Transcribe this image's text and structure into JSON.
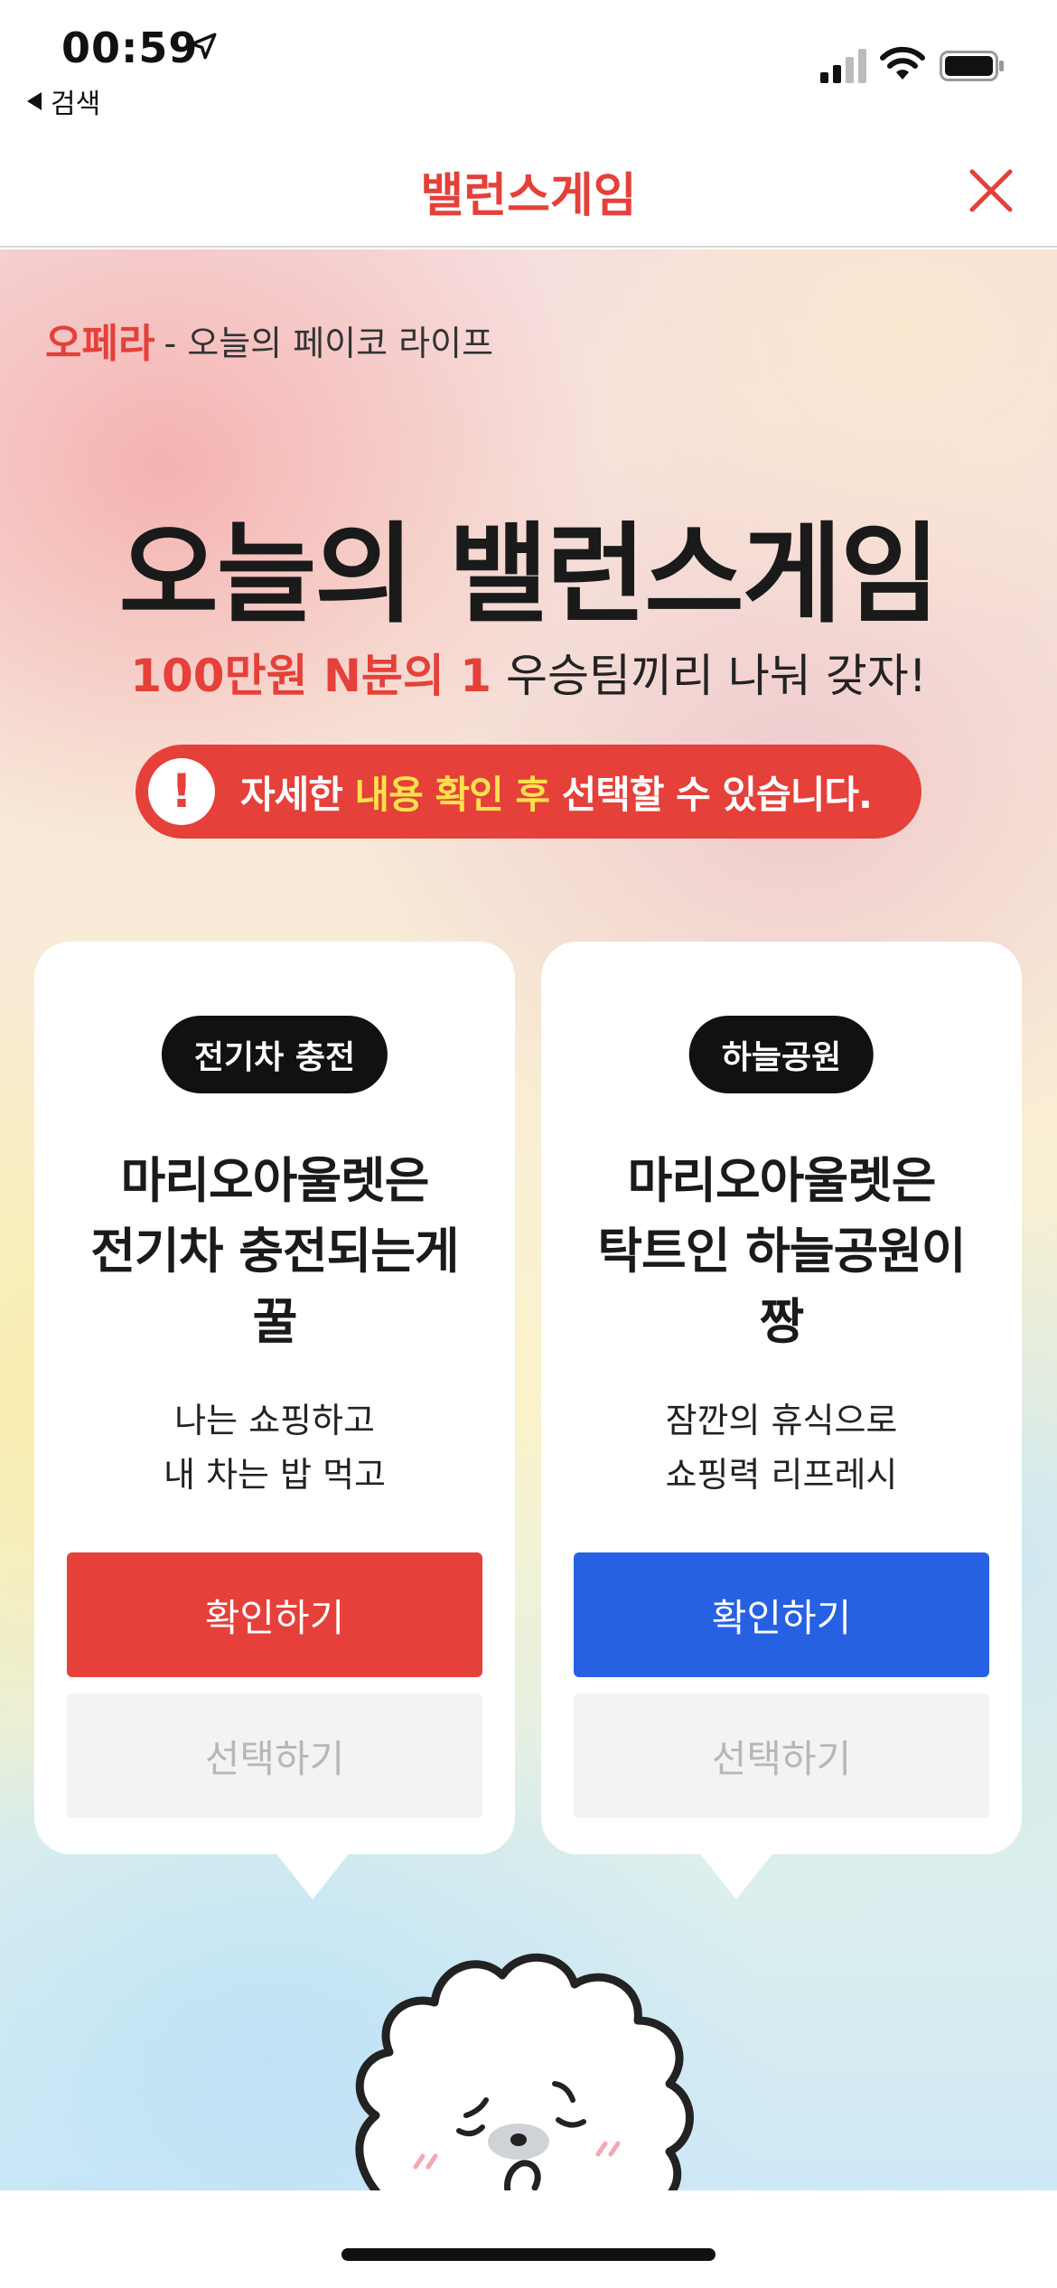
{
  "status_bar": {
    "time": "00:59",
    "back_label": "검색",
    "icons": [
      "location-arrow-icon",
      "cellular-signal-icon",
      "wifi-icon",
      "battery-icon"
    ]
  },
  "nav": {
    "title": "밸런스게임",
    "close_icon": "close-icon",
    "accent_color": "#e5403a"
  },
  "main": {
    "brand_name": "오페라",
    "brand_tagline": "- 오늘의 페이코 라이프",
    "headline": "오늘의 밸런스게임",
    "subline_highlight": "100만원 N분의 1",
    "subline_rest": " 우승팀끼리 나눠 갖자!",
    "notice": {
      "icon": "exclamation-icon",
      "text_before": "자세한 ",
      "text_highlight": "내용 확인 후",
      "text_after": " 선택할 수 있습니다."
    }
  },
  "options": [
    {
      "badge": "전기차 충전",
      "title": "마리오아울렛은\n전기차 충전되는게\n꿀",
      "description": "나는 쇼핑하고\n내 차는 밥 먹고",
      "confirm_label": "확인하기",
      "select_label": "선택하기",
      "color": "#e5403a"
    },
    {
      "badge": "하늘공원",
      "title": "마리오아울렛은\n탁트인 하늘공원이\n짱",
      "description": "잠깐의 휴식으로\n쇼핑력 리프레시",
      "confirm_label": "확인하기",
      "select_label": "선택하기",
      "color": "#2660e3"
    }
  ],
  "mascot": {
    "icon": "sheep-mascot-icon"
  }
}
